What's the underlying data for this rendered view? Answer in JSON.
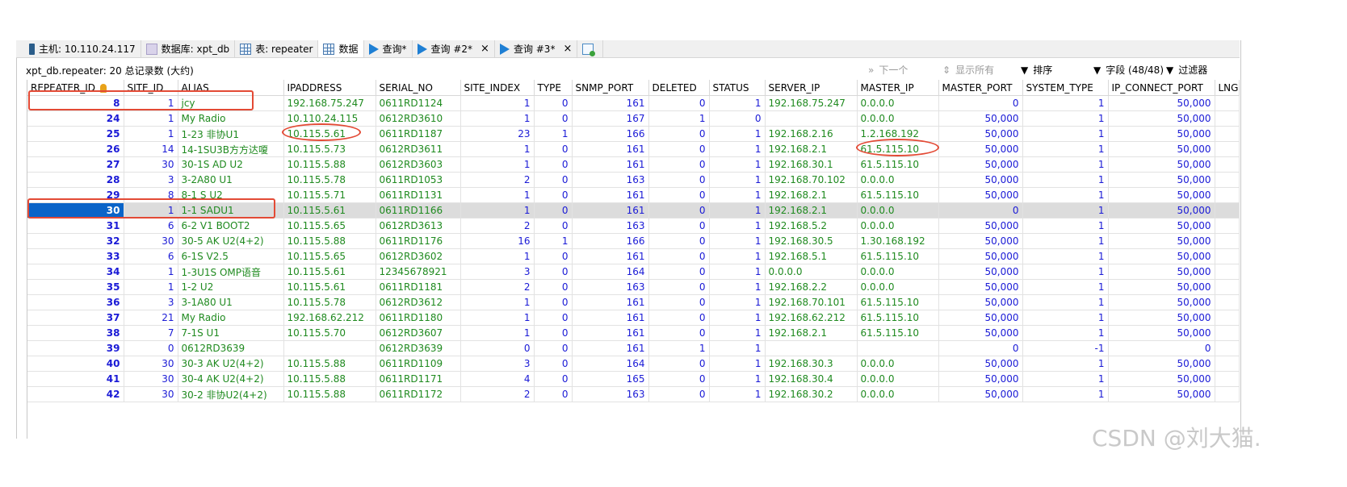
{
  "tabs": [
    {
      "icon": "host-icon",
      "label": "主机: 10.110.24.117",
      "active": false,
      "closable": false
    },
    {
      "icon": "database-icon",
      "label": "数据库: xpt_db",
      "active": false,
      "closable": false
    },
    {
      "icon": "table-icon",
      "label": "表: repeater",
      "active": false,
      "closable": false
    },
    {
      "icon": "grid-icon",
      "label": "数据",
      "active": true,
      "closable": false
    },
    {
      "icon": "query-play-icon",
      "label": "查询*",
      "active": false,
      "closable": false
    },
    {
      "icon": "query-play-icon",
      "label": "查询 #2*",
      "active": false,
      "closable": true
    },
    {
      "icon": "query-play-icon",
      "label": "查询 #3*",
      "active": false,
      "closable": true
    },
    {
      "icon": "new-query-icon",
      "label": "",
      "active": false,
      "closable": false
    }
  ],
  "info": {
    "summary": "xpt_db.repeater: 20 总记录数 (大约)",
    "next_label": "下一个",
    "show_all_label": "显示所有",
    "sort_label": "排序",
    "fields_label": "字段 (48/48)",
    "filter_label": "过滤器"
  },
  "grid": {
    "columns": [
      "REPEATER_ID",
      "SITE_ID",
      "ALIAS",
      "IPADDRESS",
      "SERIAL_NO",
      "SITE_INDEX",
      "TYPE",
      "SNMP_PORT",
      "DELETED",
      "STATUS",
      "SERVER_IP",
      "MASTER_IP",
      "MASTER_PORT",
      "SYSTEM_TYPE",
      "IP_CONNECT_PORT",
      "LNG"
    ],
    "rows": [
      [
        "8",
        "1",
        "jcy",
        "192.168.75.247",
        "0611RD1124",
        "1",
        "0",
        "161",
        "0",
        "1",
        "192.168.75.247",
        "0.0.0.0",
        "0",
        "1",
        "50,000",
        ""
      ],
      [
        "24",
        "1",
        "My Radio",
        "10.110.24.115",
        "0612RD3610",
        "1",
        "0",
        "167",
        "1",
        "0",
        "",
        "0.0.0.0",
        "50,000",
        "1",
        "50,000",
        ""
      ],
      [
        "25",
        "1",
        "1-23 非协U1",
        "10.115.5.61",
        "0611RD1187",
        "23",
        "1",
        "166",
        "0",
        "1",
        "192.168.2.16",
        "1.2.168.192",
        "50,000",
        "1",
        "50,000",
        ""
      ],
      [
        "26",
        "14",
        "14-1SU3B方方达嗄",
        "10.115.5.73",
        "0612RD3611",
        "1",
        "0",
        "161",
        "0",
        "1",
        "192.168.2.1",
        "61.5.115.10",
        "50,000",
        "1",
        "50,000",
        ""
      ],
      [
        "27",
        "30",
        "30-1S AD U2",
        "10.115.5.88",
        "0612RD3603",
        "1",
        "0",
        "161",
        "0",
        "1",
        "192.168.30.1",
        "61.5.115.10",
        "50,000",
        "1",
        "50,000",
        ""
      ],
      [
        "28",
        "3",
        "3-2A80 U1",
        "10.115.5.78",
        "0611RD1053",
        "2",
        "0",
        "163",
        "0",
        "1",
        "192.168.70.102",
        "0.0.0.0",
        "50,000",
        "1",
        "50,000",
        ""
      ],
      [
        "29",
        "8",
        "8-1 S U2",
        "10.115.5.71",
        "0611RD1131",
        "1",
        "0",
        "161",
        "0",
        "1",
        "192.168.2.1",
        "61.5.115.10",
        "50,000",
        "1",
        "50,000",
        ""
      ],
      [
        "30",
        "1",
        "1-1 SADU1",
        "10.115.5.61",
        "0611RD1166",
        "1",
        "0",
        "161",
        "0",
        "1",
        "192.168.2.1",
        "0.0.0.0",
        "0",
        "1",
        "50,000",
        ""
      ],
      [
        "31",
        "6",
        "6-2 V1 BOOT2",
        "10.115.5.65",
        "0612RD3613",
        "2",
        "0",
        "163",
        "0",
        "1",
        "192.168.5.2",
        "0.0.0.0",
        "50,000",
        "1",
        "50,000",
        ""
      ],
      [
        "32",
        "30",
        "30-5 AK U2(4+2)",
        "10.115.5.88",
        "0611RD1176",
        "16",
        "1",
        "166",
        "0",
        "1",
        "192.168.30.5",
        "1.30.168.192",
        "50,000",
        "1",
        "50,000",
        ""
      ],
      [
        "33",
        "6",
        "6-1S V2.5",
        "10.115.5.65",
        "0612RD3602",
        "1",
        "0",
        "161",
        "0",
        "1",
        "192.168.5.1",
        "61.5.115.10",
        "50,000",
        "1",
        "50,000",
        ""
      ],
      [
        "34",
        "1",
        "1-3U1S OMP语音",
        "10.115.5.61",
        "12345678921",
        "3",
        "0",
        "164",
        "0",
        "1",
        "0.0.0.0",
        "0.0.0.0",
        "50,000",
        "1",
        "50,000",
        ""
      ],
      [
        "35",
        "1",
        "1-2 U2",
        "10.115.5.61",
        "0611RD1181",
        "2",
        "0",
        "163",
        "0",
        "1",
        "192.168.2.2",
        "0.0.0.0",
        "50,000",
        "1",
        "50,000",
        ""
      ],
      [
        "36",
        "3",
        "3-1A80 U1",
        "10.115.5.78",
        "0612RD3612",
        "1",
        "0",
        "161",
        "0",
        "1",
        "192.168.70.101",
        "61.5.115.10",
        "50,000",
        "1",
        "50,000",
        ""
      ],
      [
        "37",
        "21",
        "My Radio",
        "192.168.62.212",
        "0611RD1180",
        "1",
        "0",
        "161",
        "0",
        "1",
        "192.168.62.212",
        "61.5.115.10",
        "50,000",
        "1",
        "50,000",
        ""
      ],
      [
        "38",
        "7",
        "7-1S U1",
        "10.115.5.70",
        "0612RD3607",
        "1",
        "0",
        "161",
        "0",
        "1",
        "192.168.2.1",
        "61.5.115.10",
        "50,000",
        "1",
        "50,000",
        ""
      ],
      [
        "39",
        "0",
        "0612RD3639",
        "",
        "0612RD3639",
        "0",
        "0",
        "161",
        "1",
        "1",
        "",
        "",
        "0",
        "-1",
        "0",
        ""
      ],
      [
        "40",
        "30",
        "30-3 AK U2(4+2)",
        "10.115.5.88",
        "0611RD1109",
        "3",
        "0",
        "164",
        "0",
        "1",
        "192.168.30.3",
        "0.0.0.0",
        "50,000",
        "1",
        "50,000",
        ""
      ],
      [
        "41",
        "30",
        "30-4 AK U2(4+2)",
        "10.115.5.88",
        "0611RD1171",
        "4",
        "0",
        "165",
        "0",
        "1",
        "192.168.30.4",
        "0.0.0.0",
        "50,000",
        "1",
        "50,000",
        ""
      ],
      [
        "42",
        "30",
        "30-2 非协U2(4+2)",
        "10.115.5.88",
        "0611RD1172",
        "2",
        "0",
        "163",
        "0",
        "1",
        "192.168.30.2",
        "0.0.0.0",
        "50,000",
        "1",
        "50,000",
        ""
      ]
    ],
    "selected_row": 7
  },
  "watermark": "CSDN @刘大猫.",
  "colors": {
    "accent": "#0a64c8",
    "number": "#1a1ad6",
    "text": "#1f8a1f",
    "annotation": "#e34a35"
  }
}
